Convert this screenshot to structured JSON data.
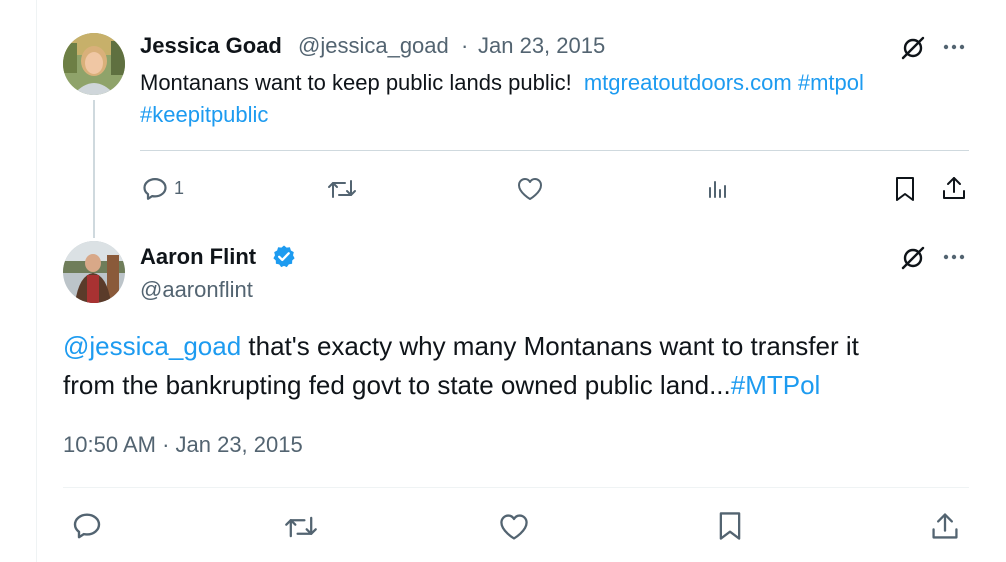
{
  "parent_tweet": {
    "author_name": "Jessica Goad",
    "handle": "@jessica_goad",
    "separator": "·",
    "date": "Jan 23, 2015",
    "text_main": "Montanans want to keep public lands public!",
    "link_url": "mtgreatoutdoors.com",
    "hashtag_1": "#mtpol",
    "hashtag_2": "#keepitpublic",
    "reply_count": "1"
  },
  "main_tweet": {
    "author_name": "Aaron Flint",
    "handle": "@aaronflint",
    "mention": "@jessica_goad",
    "text_line1": "that's exacty why many Montanans want to transfer it",
    "text_line2": "from the bankrupting fed govt to state owned public land...",
    "hashtag": "#MTPol",
    "timestamp": "10:50 AM · Jan 23, 2015"
  },
  "colors": {
    "link": "#1d9bf0",
    "muted": "#536471",
    "verified": "#1d9bf0"
  },
  "icons": [
    "grok-icon",
    "more-icon",
    "reply-icon",
    "retweet-icon",
    "like-icon",
    "views-icon",
    "bookmark-icon",
    "share-icon",
    "verified-badge-icon"
  ]
}
